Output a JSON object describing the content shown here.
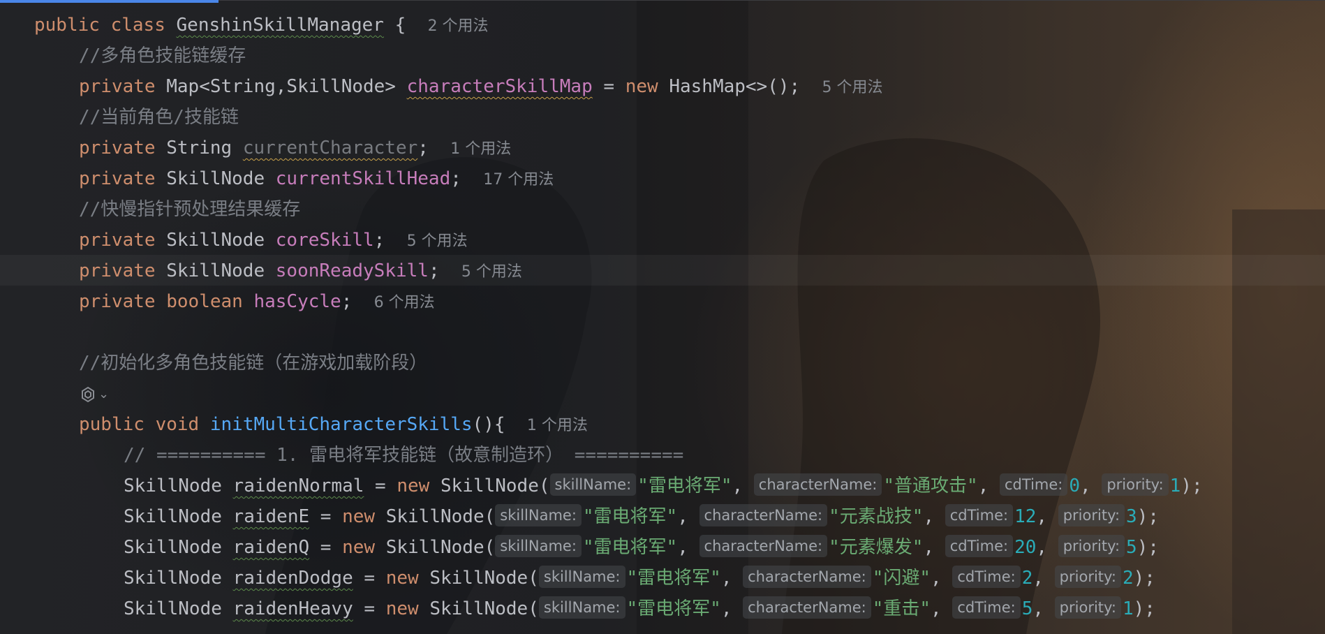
{
  "editor": {
    "accent": "#4a86e8",
    "lines": [
      {
        "indent": 1,
        "tokens": [
          {
            "t": "kw",
            "v": "public"
          },
          {
            "t": "sp",
            "v": " "
          },
          {
            "t": "kw",
            "v": "class"
          },
          {
            "t": "sp",
            "v": " "
          },
          {
            "t": "cls",
            "v": "GenshinSkillManager",
            "sq": "g"
          },
          {
            "t": "sp",
            "v": " "
          },
          {
            "t": "cls",
            "v": "{"
          },
          {
            "t": "sp",
            "v": "  "
          },
          {
            "t": "usage",
            "v": "2 个用法"
          }
        ]
      },
      {
        "indent": 2,
        "tokens": [
          {
            "t": "cmt",
            "v": "//多角色技能链缓存"
          }
        ]
      },
      {
        "indent": 2,
        "tokens": [
          {
            "t": "kw",
            "v": "private"
          },
          {
            "t": "sp",
            "v": " "
          },
          {
            "t": "cls",
            "v": "Map<String,SkillNode>"
          },
          {
            "t": "sp",
            "v": " "
          },
          {
            "t": "fld",
            "v": "characterSkillMap",
            "sq": "y"
          },
          {
            "t": "cls",
            "v": " = "
          },
          {
            "t": "kw",
            "v": "new"
          },
          {
            "t": "sp",
            "v": " "
          },
          {
            "t": "cls",
            "v": "HashMap<>();"
          },
          {
            "t": "sp",
            "v": "  "
          },
          {
            "t": "usage",
            "v": "5 个用法"
          }
        ]
      },
      {
        "indent": 2,
        "tokens": [
          {
            "t": "cmt",
            "v": "//当前角色/技能链"
          }
        ]
      },
      {
        "indent": 2,
        "tokens": [
          {
            "t": "kw",
            "v": "private"
          },
          {
            "t": "sp",
            "v": " "
          },
          {
            "t": "cls",
            "v": "String"
          },
          {
            "t": "sp",
            "v": " "
          },
          {
            "t": "fld-unused",
            "v": "currentCharacter",
            "sq": "y"
          },
          {
            "t": "cls",
            "v": ";"
          },
          {
            "t": "sp",
            "v": "  "
          },
          {
            "t": "usage",
            "v": "1 个用法"
          }
        ]
      },
      {
        "indent": 2,
        "tokens": [
          {
            "t": "kw",
            "v": "private"
          },
          {
            "t": "sp",
            "v": " "
          },
          {
            "t": "cls",
            "v": "SkillNode"
          },
          {
            "t": "sp",
            "v": " "
          },
          {
            "t": "fld",
            "v": "currentSkillHead"
          },
          {
            "t": "cls",
            "v": ";"
          },
          {
            "t": "sp",
            "v": "  "
          },
          {
            "t": "usage",
            "v": "17 个用法"
          }
        ]
      },
      {
        "indent": 2,
        "tokens": [
          {
            "t": "cmt",
            "v": "//快慢指针预处理结果缓存"
          }
        ]
      },
      {
        "indent": 2,
        "tokens": [
          {
            "t": "kw",
            "v": "private"
          },
          {
            "t": "sp",
            "v": " "
          },
          {
            "t": "cls",
            "v": "SkillNode"
          },
          {
            "t": "sp",
            "v": " "
          },
          {
            "t": "fld",
            "v": "coreSkill"
          },
          {
            "t": "cls",
            "v": ";"
          },
          {
            "t": "sp",
            "v": "  "
          },
          {
            "t": "usage",
            "v": "5 个用法"
          }
        ]
      },
      {
        "indent": 2,
        "tokens": [
          {
            "t": "kw",
            "v": "private"
          },
          {
            "t": "sp",
            "v": " "
          },
          {
            "t": "cls",
            "v": "SkillNode"
          },
          {
            "t": "sp",
            "v": " "
          },
          {
            "t": "fld",
            "v": "soonReadySkill"
          },
          {
            "t": "cls",
            "v": ";"
          },
          {
            "t": "sp",
            "v": "  "
          },
          {
            "t": "usage",
            "v": "5 个用法"
          }
        ]
      },
      {
        "indent": 2,
        "tokens": [
          {
            "t": "kw",
            "v": "private"
          },
          {
            "t": "sp",
            "v": " "
          },
          {
            "t": "kw",
            "v": "boolean"
          },
          {
            "t": "sp",
            "v": " "
          },
          {
            "t": "fld",
            "v": "hasCycle"
          },
          {
            "t": "cls",
            "v": ";"
          },
          {
            "t": "sp",
            "v": "  "
          },
          {
            "t": "usage",
            "v": "6 个用法"
          }
        ]
      },
      {
        "indent": 2,
        "tokens": []
      },
      {
        "indent": 2,
        "tokens": [
          {
            "t": "cmt",
            "v": "//初始化多角色技能链（在游戏加载阶段）"
          }
        ]
      },
      {
        "indent": 2,
        "tokens": [
          {
            "t": "ai",
            "v": "ai-assistant-icon"
          },
          {
            "t": "chev",
            "v": "⌄"
          }
        ]
      },
      {
        "indent": 2,
        "tokens": [
          {
            "t": "kw",
            "v": "public"
          },
          {
            "t": "sp",
            "v": " "
          },
          {
            "t": "kw",
            "v": "void"
          },
          {
            "t": "sp",
            "v": " "
          },
          {
            "t": "fn",
            "v": "initMultiCharacterSkills"
          },
          {
            "t": "cls",
            "v": "(){"
          },
          {
            "t": "sp",
            "v": "  "
          },
          {
            "t": "usage",
            "v": "1 个用法"
          }
        ]
      },
      {
        "indent": 3,
        "tokens": [
          {
            "t": "cmt",
            "v": "// ========== 1. 雷电将军技能链（故意制造环） =========="
          }
        ]
      },
      {
        "indent": 3,
        "tokens": [
          {
            "t": "cls",
            "v": "SkillNode"
          },
          {
            "t": "sp",
            "v": " "
          },
          {
            "t": "cls",
            "v": "raidenNormal",
            "sq": "g"
          },
          {
            "t": "cls",
            "v": " = "
          },
          {
            "t": "kw",
            "v": "new"
          },
          {
            "t": "sp",
            "v": " "
          },
          {
            "t": "cls",
            "v": "SkillNode("
          },
          {
            "t": "hint",
            "v": "skillName:"
          },
          {
            "t": "str",
            "v": "\"雷电将军\""
          },
          {
            "t": "cls",
            "v": ", "
          },
          {
            "t": "hint",
            "v": "characterName:"
          },
          {
            "t": "str",
            "v": "\"普通攻击\""
          },
          {
            "t": "cls",
            "v": ", "
          },
          {
            "t": "hint",
            "v": "cdTime:"
          },
          {
            "t": "num",
            "v": "0"
          },
          {
            "t": "cls",
            "v": ", "
          },
          {
            "t": "hint",
            "v": "priority:"
          },
          {
            "t": "num",
            "v": "1"
          },
          {
            "t": "cls",
            "v": ");"
          }
        ]
      },
      {
        "indent": 3,
        "tokens": [
          {
            "t": "cls",
            "v": "SkillNode"
          },
          {
            "t": "sp",
            "v": " "
          },
          {
            "t": "cls",
            "v": "raidenE",
            "sq": "g"
          },
          {
            "t": "cls",
            "v": " = "
          },
          {
            "t": "kw",
            "v": "new"
          },
          {
            "t": "sp",
            "v": " "
          },
          {
            "t": "cls",
            "v": "SkillNode("
          },
          {
            "t": "hint",
            "v": "skillName:"
          },
          {
            "t": "str",
            "v": "\"雷电将军\""
          },
          {
            "t": "cls",
            "v": ", "
          },
          {
            "t": "hint",
            "v": "characterName:"
          },
          {
            "t": "str",
            "v": "\"元素战技\""
          },
          {
            "t": "cls",
            "v": ", "
          },
          {
            "t": "hint",
            "v": "cdTime:"
          },
          {
            "t": "num",
            "v": "12"
          },
          {
            "t": "cls",
            "v": ", "
          },
          {
            "t": "hint",
            "v": "priority:"
          },
          {
            "t": "num",
            "v": "3"
          },
          {
            "t": "cls",
            "v": ");"
          }
        ]
      },
      {
        "indent": 3,
        "tokens": [
          {
            "t": "cls",
            "v": "SkillNode"
          },
          {
            "t": "sp",
            "v": " "
          },
          {
            "t": "cls",
            "v": "raidenQ",
            "sq": "g"
          },
          {
            "t": "cls",
            "v": " = "
          },
          {
            "t": "kw",
            "v": "new"
          },
          {
            "t": "sp",
            "v": " "
          },
          {
            "t": "cls",
            "v": "SkillNode("
          },
          {
            "t": "hint",
            "v": "skillName:"
          },
          {
            "t": "str",
            "v": "\"雷电将军\""
          },
          {
            "t": "cls",
            "v": ", "
          },
          {
            "t": "hint",
            "v": "characterName:"
          },
          {
            "t": "str",
            "v": "\"元素爆发\""
          },
          {
            "t": "cls",
            "v": ", "
          },
          {
            "t": "hint",
            "v": "cdTime:"
          },
          {
            "t": "num",
            "v": "20"
          },
          {
            "t": "cls",
            "v": ", "
          },
          {
            "t": "hint",
            "v": "priority:"
          },
          {
            "t": "num",
            "v": "5"
          },
          {
            "t": "cls",
            "v": ");"
          }
        ]
      },
      {
        "indent": 3,
        "tokens": [
          {
            "t": "cls",
            "v": "SkillNode"
          },
          {
            "t": "sp",
            "v": " "
          },
          {
            "t": "cls",
            "v": "raidenDodge",
            "sq": "g"
          },
          {
            "t": "cls",
            "v": " = "
          },
          {
            "t": "kw",
            "v": "new"
          },
          {
            "t": "sp",
            "v": " "
          },
          {
            "t": "cls",
            "v": "SkillNode("
          },
          {
            "t": "hint",
            "v": "skillName:"
          },
          {
            "t": "str",
            "v": "\"雷电将军\""
          },
          {
            "t": "cls",
            "v": ", "
          },
          {
            "t": "hint",
            "v": "characterName:"
          },
          {
            "t": "str",
            "v": "\"闪避\""
          },
          {
            "t": "cls",
            "v": ", "
          },
          {
            "t": "hint",
            "v": "cdTime:"
          },
          {
            "t": "num",
            "v": "2"
          },
          {
            "t": "cls",
            "v": ", "
          },
          {
            "t": "hint",
            "v": "priority:"
          },
          {
            "t": "num",
            "v": "2"
          },
          {
            "t": "cls",
            "v": ");"
          }
        ]
      },
      {
        "indent": 3,
        "tokens": [
          {
            "t": "cls",
            "v": "SkillNode"
          },
          {
            "t": "sp",
            "v": " "
          },
          {
            "t": "cls",
            "v": "raidenHeavy",
            "sq": "g"
          },
          {
            "t": "cls",
            "v": " = "
          },
          {
            "t": "kw",
            "v": "new"
          },
          {
            "t": "sp",
            "v": " "
          },
          {
            "t": "cls",
            "v": "SkillNode("
          },
          {
            "t": "hint",
            "v": "skillName:"
          },
          {
            "t": "str",
            "v": "\"雷电将军\""
          },
          {
            "t": "cls",
            "v": ", "
          },
          {
            "t": "hint",
            "v": "characterName:"
          },
          {
            "t": "str",
            "v": "\"重击\""
          },
          {
            "t": "cls",
            "v": ", "
          },
          {
            "t": "hint",
            "v": "cdTime:"
          },
          {
            "t": "num",
            "v": "5"
          },
          {
            "t": "cls",
            "v": ", "
          },
          {
            "t": "hint",
            "v": "priority:"
          },
          {
            "t": "num",
            "v": "1"
          },
          {
            "t": "cls",
            "v": ");"
          }
        ]
      }
    ]
  }
}
